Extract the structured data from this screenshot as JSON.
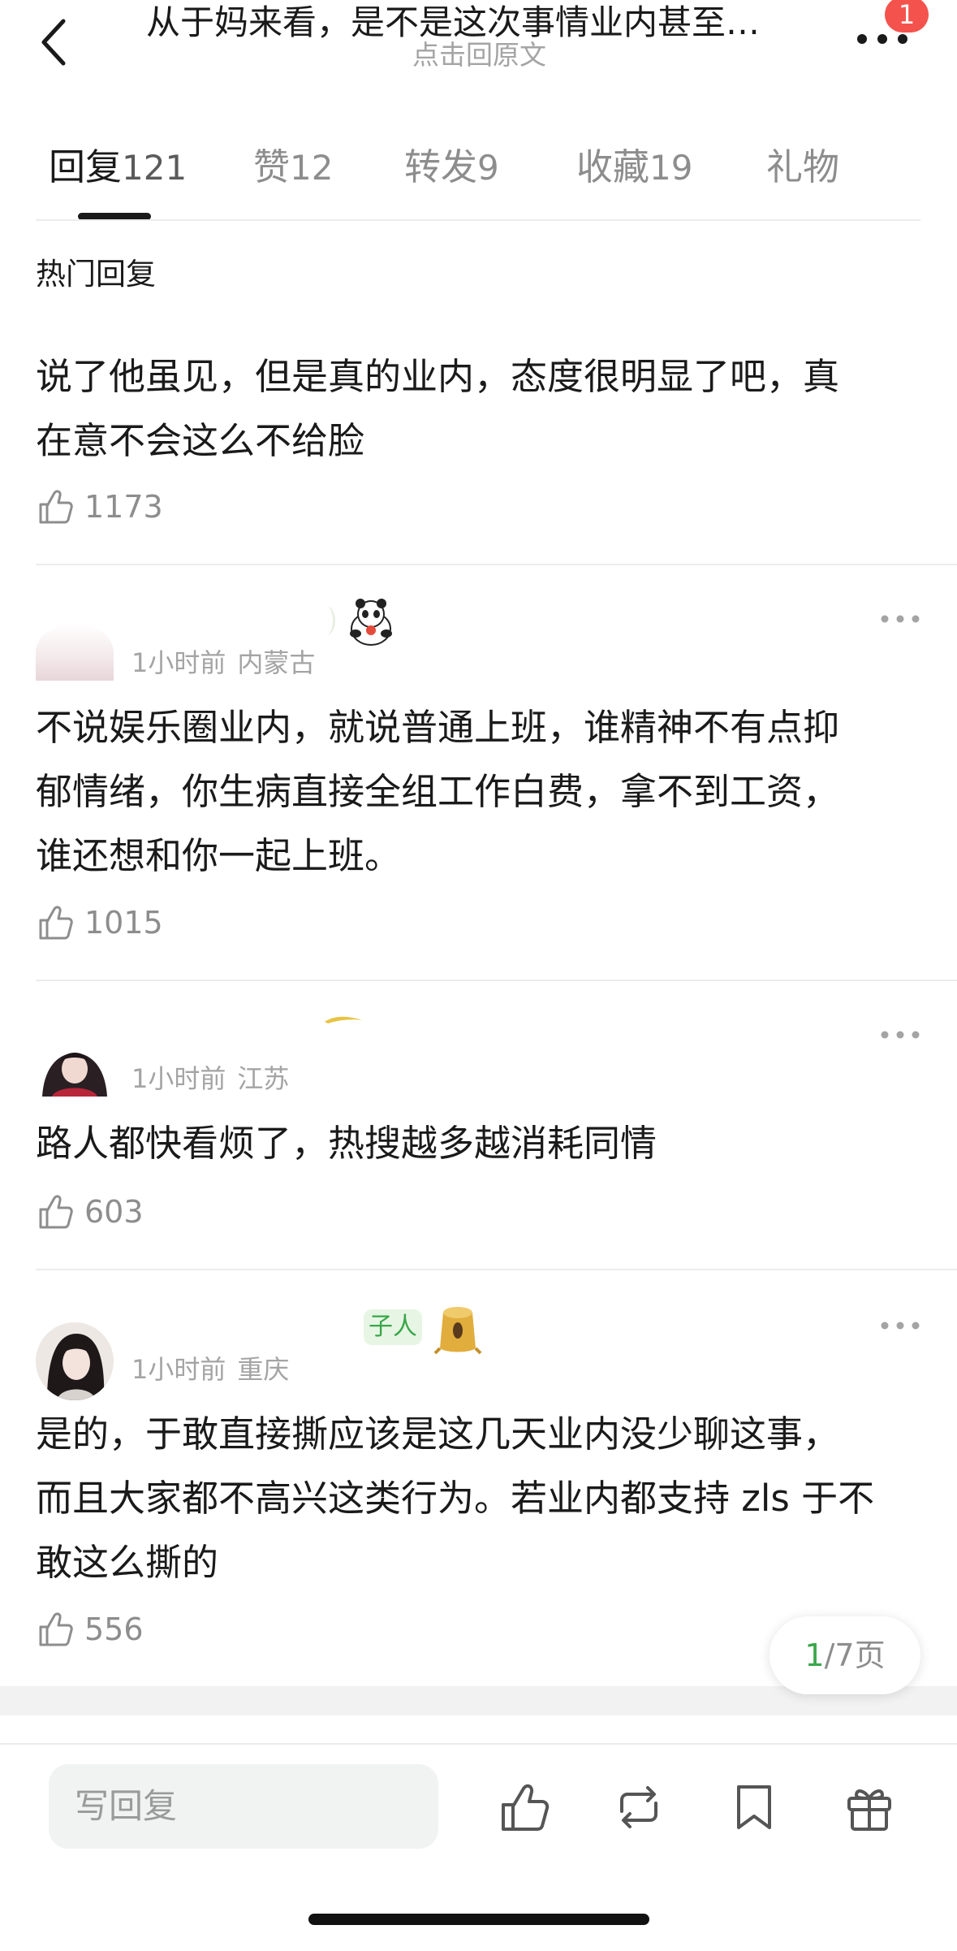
{
  "header": {
    "title": "从于妈来看，是不是这次事情业内甚至…",
    "subtitle": "点击回原文",
    "notification_count": "1"
  },
  "tabs": [
    {
      "label": "回复",
      "count": "121",
      "active": true
    },
    {
      "label": "赞",
      "count": "12",
      "active": false
    },
    {
      "label": "转发",
      "count": "9",
      "active": false
    },
    {
      "label": "收藏",
      "count": "19",
      "active": false
    },
    {
      "label": "礼物",
      "count": "",
      "active": false
    }
  ],
  "section_title": "热门回复",
  "comments": [
    {
      "text_lines": [
        "说了他虽见，但是真的业内，态度很明显了吧，真",
        "在意不会这么不给脸"
      ],
      "likes": "1173"
    },
    {
      "time": "1小时前",
      "location": "内蒙古",
      "text_lines": [
        "不说娱乐圈业内，就说普通上班，谁精神不有点抑",
        "郁情绪，你生病直接全组工作白费，拿不到工资，",
        "谁还想和你一起上班。"
      ],
      "likes": "1015"
    },
    {
      "time": "1小时前",
      "location": "江苏",
      "text_lines": [
        "路人都快看烦了，热搜越多越消耗同情"
      ],
      "likes": "603"
    },
    {
      "time": "1小时前",
      "location": "重庆",
      "badge": "子人",
      "text_lines": [
        "是的，于敢直接撕应该是这几天业内没少聊这事，",
        "而且大家都不高兴这类行为。若业内都支持 zls 于不",
        "敢这么撕的"
      ],
      "likes": "556"
    }
  ],
  "pagination": {
    "current": "1",
    "total": "/7",
    "unit": "页"
  },
  "bottom_bar": {
    "reply_placeholder": "写回复"
  },
  "colors": {
    "accent_green": "#3aa64a",
    "badge_red": "#f4524d",
    "muted": "#8d8d8d"
  }
}
